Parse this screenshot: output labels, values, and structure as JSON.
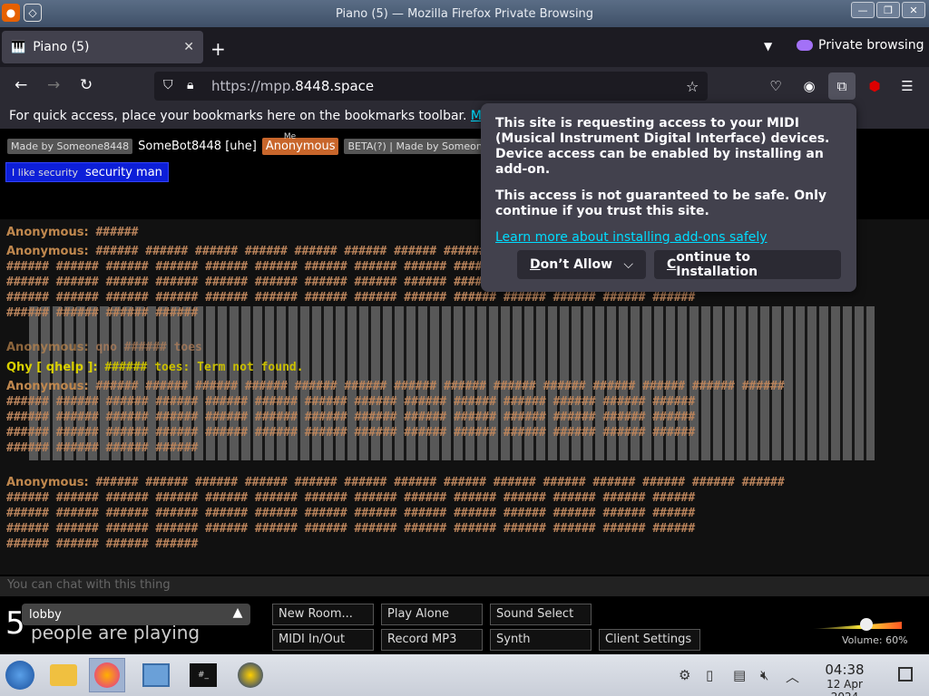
{
  "window": {
    "title": "Piano (5) — Mozilla Firefox Private Browsing"
  },
  "tab": {
    "title": "Piano (5)",
    "new_tab": "+",
    "private_label": "Private browsing"
  },
  "nav": {
    "url_prefix": "https://mpp.",
    "url_domain": "8448.space"
  },
  "bookmarks": {
    "text": "For quick access, place your bookmarks here on the bookmarks toolbar.",
    "link": "Mana"
  },
  "users": {
    "tag1": "Made by Someone8448",
    "name1": "SomeBot8448 [uhe]",
    "me_label": "Me",
    "anon": "Anonymous",
    "tag2": "BETA(?) | Made by Someone8448",
    "sec_tag": "I like security",
    "sec_name": "security man"
  },
  "chat": {
    "messages": [
      {
        "nick": "Anonymous:",
        "text": "######"
      },
      {
        "nick": "Anonymous:",
        "text": "###### ###### ###### ###### ###### ###### ###### ###### ###### ###### ###### ###### ###### ######\n###### ###### ###### ###### ###### ###### ###### ###### ###### ###### ###### ###### ###### ######\n###### ###### ###### ###### ###### ###### ###### ###### ###### ###### ###### ###### ###### ######\n###### ###### ###### ###### ###### ###### ###### ###### ###### ###### ###### ###### ###### ######\n###### ###### ###### ######"
      },
      {
        "nick": "Anonymous:",
        "text": "qno ###### toes"
      },
      {
        "nick": "Qhy [ qhelp ]:",
        "text": "###### toes: Term not found."
      },
      {
        "nick": "Anonymous:",
        "text": "###### ###### ###### ###### ###### ###### ###### ###### ###### ###### ###### ###### ###### ######\n###### ###### ###### ###### ###### ###### ###### ###### ###### ###### ###### ###### ###### ######\n###### ###### ###### ###### ###### ###### ###### ###### ###### ###### ###### ###### ###### ######\n###### ###### ###### ###### ###### ###### ###### ###### ###### ###### ###### ###### ###### ######\n###### ###### ###### ######"
      },
      {
        "nick": "Anonymous:",
        "text": "###### ###### ###### ###### ###### ###### ###### ###### ###### ###### ###### ###### ###### ######\n###### ###### ###### ###### ###### ###### ###### ###### ###### ###### ###### ###### ###### ######\n###### ###### ###### ###### ###### ###### ###### ###### ###### ###### ###### ###### ###### ######\n###### ###### ###### ###### ###### ###### ###### ###### ###### ###### ###### ###### ###### ######\n###### ###### ###### ######"
      }
    ],
    "placeholder": "You can chat with this thing"
  },
  "bottom": {
    "count": "5",
    "count_label": "people are playing",
    "room": "lobby",
    "buttons": {
      "new_room": "New Room...",
      "play_alone": "Play Alone",
      "sound_select": "Sound Select",
      "midi": "MIDI In/Out",
      "record": "Record MP3",
      "synth": "Synth",
      "client_settings": "Client Settings"
    },
    "volume_label": "Volume: 60%",
    "volume_value": 0.6
  },
  "popup": {
    "line1": "This site is requesting access to your MIDI (Musical Instrument Digital Interface) devices. Device access can be enabled by installing an add-on.",
    "line2": "This access is not guaranteed to be safe. Only continue if you trust this site.",
    "link": "Learn more about installing add-ons safely",
    "deny_key": "D",
    "deny_rest": "on’t Allow",
    "continue_key": "C",
    "continue_rest": "ontinue to Installation"
  },
  "taskbar": {
    "time": "04:38",
    "date": "12 Apr 2024"
  },
  "colors": {
    "accent": "#00ddff",
    "anon_tag": "#c8662b",
    "security_tag": "#0d1fd8"
  }
}
